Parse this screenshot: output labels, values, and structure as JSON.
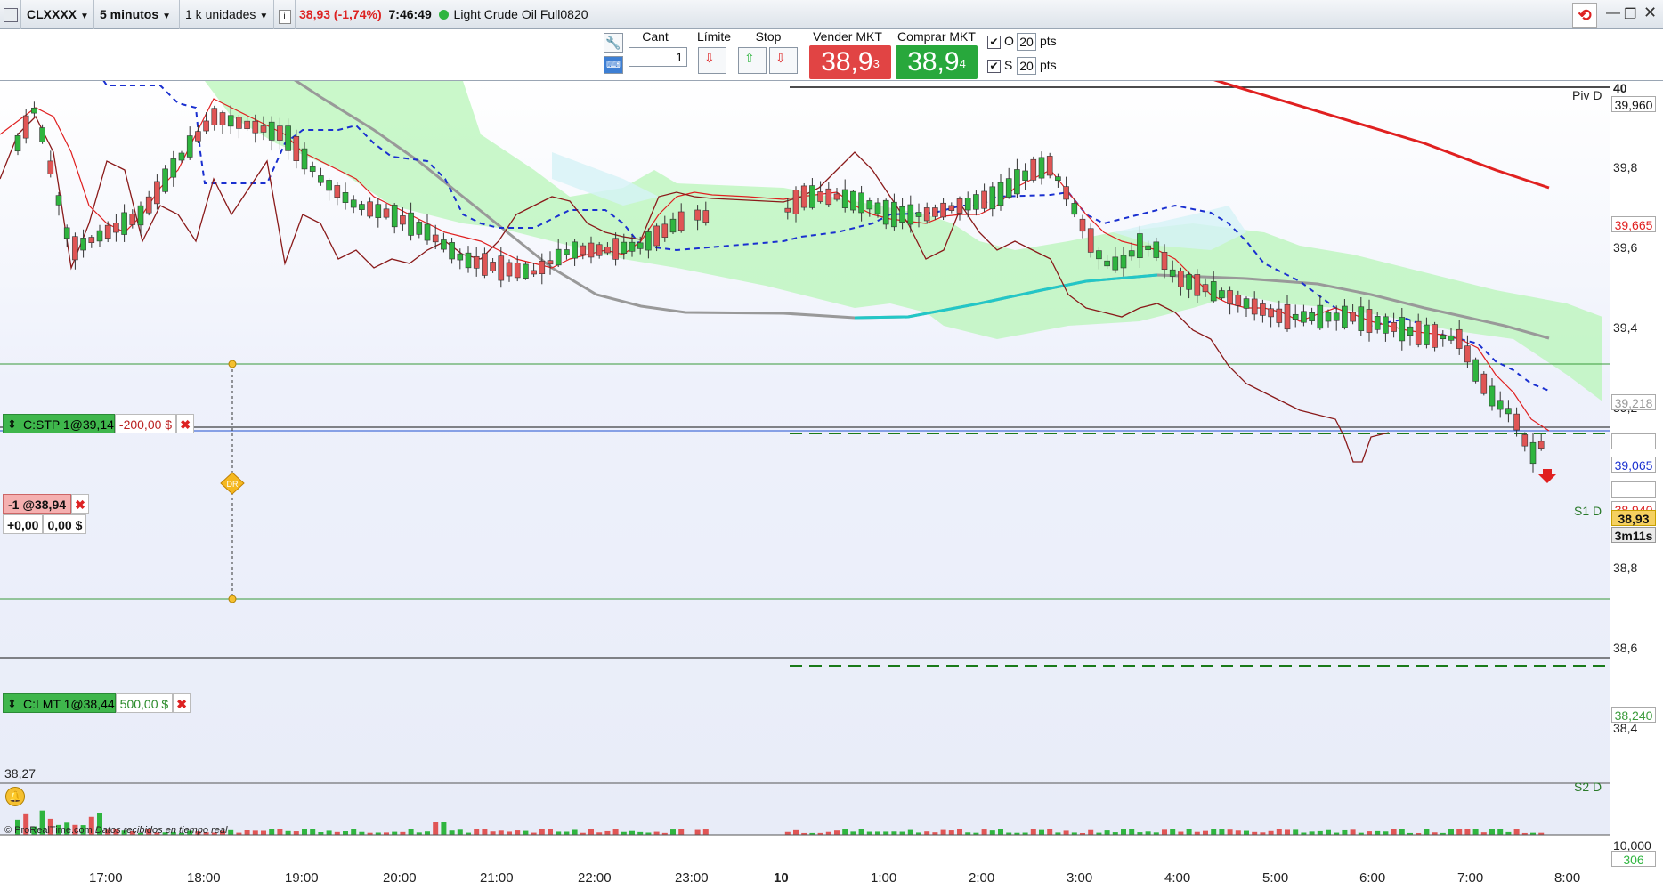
{
  "toolbar": {
    "symbol": "CLXXXX",
    "timeframe": "5 minutos",
    "units": "1 k unidades",
    "price_change": "38,93 (-1,74%)",
    "time": "7:46:49",
    "instrument": "Light Crude Oil Full0820"
  },
  "order_bar": {
    "qty_label": "Cant",
    "qty_value": "1",
    "limit_label": "Límite",
    "stop_label": "Stop",
    "sell_label": "Vender MKT",
    "sell_price_main": "38,9",
    "sell_price_sup": "3",
    "buy_label": "Comprar MKT",
    "buy_price_main": "38,9",
    "buy_price_sup": "4",
    "o_label": "O",
    "o_value": "20",
    "o_unit": "pts",
    "s_label": "S",
    "s_value": "20",
    "s_unit": "pts"
  },
  "orders": {
    "stop_label": "C:STP 1@39,14",
    "stop_pl": "-200,00 $",
    "position_label": "-1 @38,94",
    "position_pts": "+0,00",
    "position_pl": "0,00 $",
    "limit_label": "C:LMT 1@38,44",
    "limit_pl": "500,00 $",
    "dr_label": "DR"
  },
  "levels": {
    "piv": "Piv D",
    "s1": "S1 D",
    "s2": "S2 D",
    "low_price": "38,27"
  },
  "yaxis": {
    "ticks": [
      "40",
      "39,8",
      "39,6",
      "39,4",
      "39,2",
      "38,8",
      "38,6",
      "38,4"
    ],
    "tag_pivot": "39,960",
    "tag_red": "39,665",
    "tag_gray": "39,218",
    "tag_blue": "39,065",
    "tag_s1": "38,940",
    "tag_last": "38,93",
    "tag_countdown": "3m11s",
    "tag_s2": "38,240",
    "vol_max": "10,000",
    "vol_last": "306"
  },
  "xaxis": [
    "17:00",
    "18:00",
    "19:00",
    "20:00",
    "21:00",
    "22:00",
    "23:00",
    "10",
    "1:00",
    "2:00",
    "3:00",
    "4:00",
    "5:00",
    "6:00",
    "7:00",
    "8:00"
  ],
  "footer": {
    "brand": "© ProRealTime.com",
    "note": "Datos recibidos en tiempo real"
  },
  "colors": {
    "bull": "#2fb53f",
    "bear": "#e05555",
    "cloud": "#b8f5b8",
    "sma_red": "#e02020",
    "teal": "#22c7c7"
  }
}
